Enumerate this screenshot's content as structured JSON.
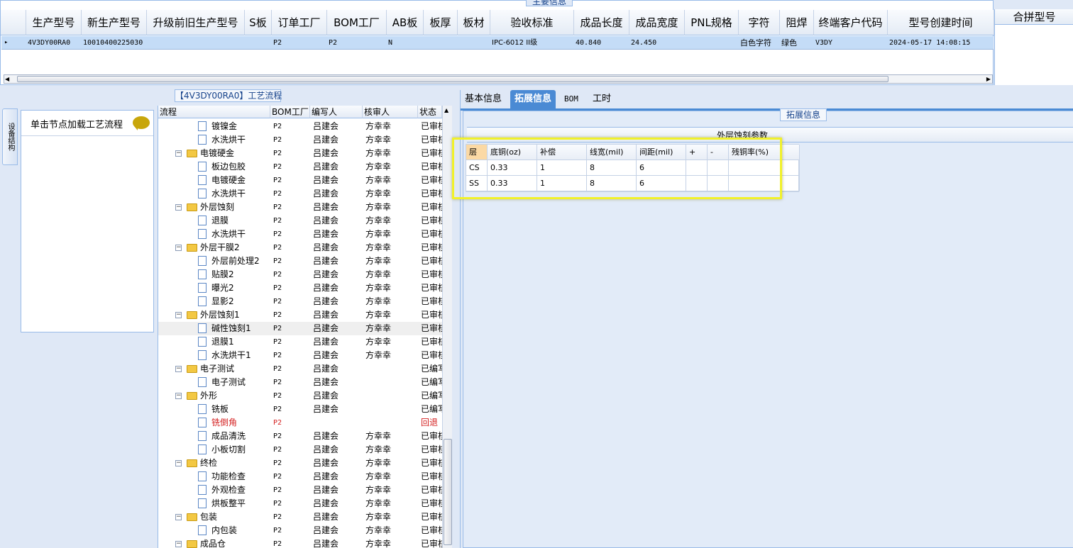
{
  "top_section": {
    "caption": "主要信息",
    "columns": [
      "生产型号",
      "新生产型号",
      "升级前旧生产型号",
      "S板",
      "订单工厂",
      "BOM工厂",
      "AB板",
      "板厚",
      "板材",
      "验收标准",
      "成品长度",
      "成品宽度",
      "PNL规格",
      "字符",
      "阻焊",
      "终端客户代码",
      "型号创建时间"
    ],
    "row": {
      "marker": "▸",
      "production_model": "4V3DY00RA0",
      "new_model": "10010400225030",
      "old_model": "",
      "s_board": "",
      "order_factory": "P2",
      "bom_factory": "P2",
      "ab_board": "N",
      "thickness": "",
      "material": "",
      "acceptance": "IPC-6012 II级",
      "length": "40.840",
      "width": "24.450",
      "pnl": "",
      "character": "白色字符",
      "solder_mask": "绿色",
      "customer_code": "V3DY",
      "created": "2024-05-17 14:08:15"
    },
    "merge_header": "合拼型号"
  },
  "left_panel": {
    "flow_caption": "【4V3DY00RA0】工艺流程",
    "vertical_tab": "设备结构",
    "node_hint": "单击节点加载工艺流程",
    "columns": [
      "流程",
      "BOM工厂",
      "编写人",
      "核审人",
      "状态"
    ],
    "rows": [
      {
        "level": 2,
        "kind": "doc",
        "name": "镀镍金",
        "bom": "P2",
        "writer": "吕建会",
        "reviewer": "方幸幸",
        "status": "已审核"
      },
      {
        "level": 2,
        "kind": "doc",
        "name": "水洗烘干",
        "bom": "P2",
        "writer": "吕建会",
        "reviewer": "方幸幸",
        "status": "已审核"
      },
      {
        "level": 1,
        "kind": "folder",
        "name": "电镀硬金",
        "bom": "P2",
        "writer": "吕建会",
        "reviewer": "方幸幸",
        "status": "已审核"
      },
      {
        "level": 2,
        "kind": "doc",
        "name": "板边包胶",
        "bom": "P2",
        "writer": "吕建会",
        "reviewer": "方幸幸",
        "status": "已审核"
      },
      {
        "level": 2,
        "kind": "doc",
        "name": "电镀硬金",
        "bom": "P2",
        "writer": "吕建会",
        "reviewer": "方幸幸",
        "status": "已审核"
      },
      {
        "level": 2,
        "kind": "doc",
        "name": "水洗烘干",
        "bom": "P2",
        "writer": "吕建会",
        "reviewer": "方幸幸",
        "status": "已审核"
      },
      {
        "level": 1,
        "kind": "folder",
        "name": "外层蚀刻",
        "bom": "P2",
        "writer": "吕建会",
        "reviewer": "方幸幸",
        "status": "已审核"
      },
      {
        "level": 2,
        "kind": "doc",
        "name": "退膜",
        "bom": "P2",
        "writer": "吕建会",
        "reviewer": "方幸幸",
        "status": "已审核"
      },
      {
        "level": 2,
        "kind": "doc",
        "name": "水洗烘干",
        "bom": "P2",
        "writer": "吕建会",
        "reviewer": "方幸幸",
        "status": "已审核"
      },
      {
        "level": 1,
        "kind": "folder",
        "name": "外层干膜2",
        "bom": "P2",
        "writer": "吕建会",
        "reviewer": "方幸幸",
        "status": "已审核"
      },
      {
        "level": 2,
        "kind": "doc",
        "name": "外层前处理2",
        "bom": "P2",
        "writer": "吕建会",
        "reviewer": "方幸幸",
        "status": "已审核"
      },
      {
        "level": 2,
        "kind": "doc",
        "name": "贴膜2",
        "bom": "P2",
        "writer": "吕建会",
        "reviewer": "方幸幸",
        "status": "已审核"
      },
      {
        "level": 2,
        "kind": "doc",
        "name": "曝光2",
        "bom": "P2",
        "writer": "吕建会",
        "reviewer": "方幸幸",
        "status": "已审核"
      },
      {
        "level": 2,
        "kind": "doc",
        "name": "显影2",
        "bom": "P2",
        "writer": "吕建会",
        "reviewer": "方幸幸",
        "status": "已审核"
      },
      {
        "level": 1,
        "kind": "folder",
        "name": "外层蚀刻1",
        "bom": "P2",
        "writer": "吕建会",
        "reviewer": "方幸幸",
        "status": "已审核"
      },
      {
        "level": 2,
        "kind": "doc",
        "name": "碱性蚀刻1",
        "bom": "P2",
        "writer": "吕建会",
        "reviewer": "方幸幸",
        "status": "已审核",
        "selected": true
      },
      {
        "level": 2,
        "kind": "doc",
        "name": "退膜1",
        "bom": "P2",
        "writer": "吕建会",
        "reviewer": "方幸幸",
        "status": "已审核"
      },
      {
        "level": 2,
        "kind": "doc",
        "name": "水洗烘干1",
        "bom": "P2",
        "writer": "吕建会",
        "reviewer": "方幸幸",
        "status": "已审核"
      },
      {
        "level": 1,
        "kind": "folder",
        "name": "电子测试",
        "bom": "P2",
        "writer": "吕建会",
        "reviewer": "",
        "status": "已编写"
      },
      {
        "level": 2,
        "kind": "doc",
        "name": "电子测试",
        "bom": "P2",
        "writer": "吕建会",
        "reviewer": "",
        "status": "已编写"
      },
      {
        "level": 1,
        "kind": "folder",
        "name": "外形",
        "bom": "P2",
        "writer": "吕建会",
        "reviewer": "",
        "status": "已编写"
      },
      {
        "level": 2,
        "kind": "doc",
        "name": "铣板",
        "bom": "P2",
        "writer": "吕建会",
        "reviewer": "",
        "status": "已编写"
      },
      {
        "level": 2,
        "kind": "doc",
        "name": "铣倒角",
        "bom": "P2",
        "writer": "",
        "reviewer": "",
        "status": "回退",
        "red": true
      },
      {
        "level": 2,
        "kind": "doc",
        "name": "成品清洗",
        "bom": "P2",
        "writer": "吕建会",
        "reviewer": "方幸幸",
        "status": "已审核"
      },
      {
        "level": 2,
        "kind": "doc",
        "name": "小板切割",
        "bom": "P2",
        "writer": "吕建会",
        "reviewer": "方幸幸",
        "status": "已审核"
      },
      {
        "level": 1,
        "kind": "folder",
        "name": "终检",
        "bom": "P2",
        "writer": "吕建会",
        "reviewer": "方幸幸",
        "status": "已审核"
      },
      {
        "level": 2,
        "kind": "doc",
        "name": "功能检查",
        "bom": "P2",
        "writer": "吕建会",
        "reviewer": "方幸幸",
        "status": "已审核"
      },
      {
        "level": 2,
        "kind": "doc",
        "name": "外观检查",
        "bom": "P2",
        "writer": "吕建会",
        "reviewer": "方幸幸",
        "status": "已审核"
      },
      {
        "level": 2,
        "kind": "doc",
        "name": "烘板整平",
        "bom": "P2",
        "writer": "吕建会",
        "reviewer": "方幸幸",
        "status": "已审核"
      },
      {
        "level": 1,
        "kind": "folder",
        "name": "包装",
        "bom": "P2",
        "writer": "吕建会",
        "reviewer": "方幸幸",
        "status": "已审核"
      },
      {
        "level": 2,
        "kind": "doc",
        "name": "内包装",
        "bom": "P2",
        "writer": "吕建会",
        "reviewer": "方幸幸",
        "status": "已审核"
      },
      {
        "level": 1,
        "kind": "folder",
        "name": "成品仓",
        "bom": "P2",
        "writer": "吕建会",
        "reviewer": "方幸幸",
        "status": "已审核"
      }
    ]
  },
  "right_panel": {
    "tabs": [
      "基本信息",
      "拓展信息",
      "BOM",
      "工时"
    ],
    "active_tab": "拓展信息",
    "caption": "拓展信息",
    "section_title": "外层蚀刻参数",
    "param_columns": [
      "层",
      "底铜(oz)",
      "补偿",
      "线宽(mil)",
      "间距(mil)",
      "+",
      "-",
      "残铜率(%)"
    ],
    "param_rows": [
      [
        "CS",
        "0.33",
        "1",
        "8",
        "6",
        "",
        "",
        ""
      ],
      [
        "SS",
        "0.33",
        "1",
        "8",
        "6",
        "",
        "",
        ""
      ]
    ]
  },
  "colors": {
    "accent": "#4a8ad4",
    "selected_row": "#c4dcf7",
    "highlight": "#f1f12a",
    "reject": "#d42020"
  }
}
